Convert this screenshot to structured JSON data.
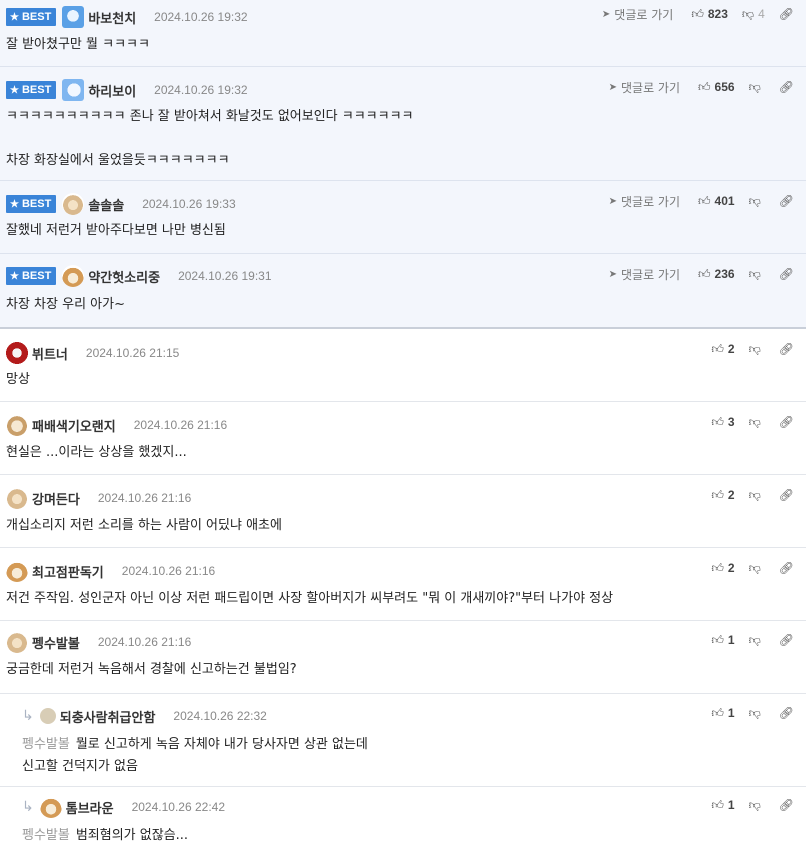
{
  "best_label": "BEST",
  "goto_label": "댓글로 가기",
  "best": [
    {
      "nick": "바보천치",
      "date": "2024.10.26 19:32",
      "text": "잘 받아쳤구만 뭘 ㅋㅋㅋㅋ",
      "up": "823",
      "down": "4"
    },
    {
      "nick": "하리보이",
      "date": "2024.10.26 19:32",
      "text": "ㅋㅋㅋㅋㅋㅋㅋㅋㅋㅋ 존나 잘 받아쳐서 화날것도 없어보인다 ㅋㅋㅋㅋㅋㅋ\n\n차장 화장실에서 울었을듯ㅋㅋㅋㅋㅋㅋㅋ",
      "up": "656"
    },
    {
      "nick": "솔솔솔",
      "date": "2024.10.26 19:33",
      "text": "잘했네 저런거 받아주다보면 나만 병신됨",
      "up": "401"
    },
    {
      "nick": "약간헛소리중",
      "date": "2024.10.26 19:31",
      "text": "차장 차장 우리 아가~",
      "up": "236"
    }
  ],
  "comments": [
    {
      "nick": "뷔트너",
      "date": "2024.10.26 21:15",
      "text": "망상",
      "up": "2"
    },
    {
      "nick": "패배색기오랜지",
      "date": "2024.10.26 21:16",
      "text": "현실은 ...이라는 상상을 했겠지...",
      "up": "3"
    },
    {
      "nick": "강며든다",
      "date": "2024.10.26 21:16",
      "text": "개십소리지 저런 소리를 하는 사람이 어딨냐 애초에",
      "up": "2"
    },
    {
      "nick": "최고점판독기",
      "date": "2024.10.26 21:16",
      "text": "저건 주작임. 성인군자 아닌 이상 저런 패드립이면 사장 할아버지가 씨부려도 \"뭐 이 개새끼야?\"부터 나가야 정상",
      "up": "2"
    },
    {
      "nick": "펭수발볼",
      "date": "2024.10.26 21:16",
      "text": "궁금한데 저런거 녹음해서 경찰에 신고하는건 불법임?",
      "up": "1"
    }
  ],
  "replies": [
    {
      "nick": "되충사람취급안함",
      "date": "2024.10.26 22:32",
      "mention": "펭수발볼",
      "text": "뭘로 신고하게 녹음 자체야 내가 당사자면 상관 없는데\n신고할 건덕지가 없음",
      "up": "1"
    },
    {
      "nick": "톰브라운",
      "date": "2024.10.26 22:42",
      "mention": "펭수발볼",
      "text": "범죄혐의가 없잖슴...",
      "up": "1"
    }
  ],
  "icons": {
    "thumb_up": "thumbs-up-icon",
    "thumb_down": "thumbs-down-icon",
    "link": "link-icon",
    "goto": "send-arrow-icon",
    "star": "star-icon",
    "reply": "reply-arrow-icon"
  },
  "colors": {
    "badge": "#3a84d8",
    "best_bg": "#f3f6fc"
  }
}
